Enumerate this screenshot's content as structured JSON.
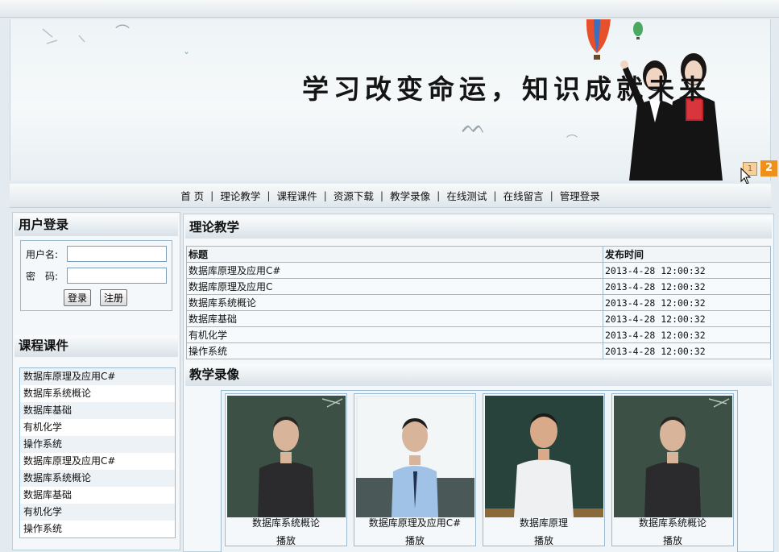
{
  "banner": {
    "slogan": "学习改变命运，知识成就未来",
    "slides": [
      "1",
      "2"
    ]
  },
  "nav": [
    "首 页",
    "理论教学",
    "课程课件",
    "资源下载",
    "教学录像",
    "在线测试",
    "在线留言",
    "管理登录"
  ],
  "nav_separator": "|",
  "login": {
    "title": "用户登录",
    "username_label": "用户名:",
    "password_label": "密　码:",
    "login_button": "登录",
    "register_button": "注册"
  },
  "courses": {
    "title": "课程课件",
    "items": [
      "数据库原理及应用C#",
      "数据库系统概论",
      "数据库基础",
      "有机化学",
      "操作系统",
      "数据库原理及应用C#",
      "数据库系统概论",
      "数据库基础",
      "有机化学",
      "操作系统"
    ]
  },
  "theory": {
    "title": "理论教学",
    "columns": [
      "标题",
      "发布时间"
    ],
    "rows": [
      [
        "数据库原理及应用C#",
        "2013-4-28 12:00:32"
      ],
      [
        "数据库原理及应用C",
        "2013-4-28 12:00:32"
      ],
      [
        "数据库系统概论",
        "2013-4-28 12:00:32"
      ],
      [
        "数据库基础",
        "2013-4-28 12:00:32"
      ],
      [
        "有机化学",
        "2013-4-28 12:00:32"
      ],
      [
        "操作系统",
        "2013-4-28 12:00:32"
      ]
    ]
  },
  "videos": {
    "title": "教学录像",
    "play_label": "播放",
    "items": [
      {
        "caption": "数据库系统概论"
      },
      {
        "caption": "数据库原理及应用C#"
      },
      {
        "caption": "数据库原理"
      },
      {
        "caption": "数据库系统概论"
      }
    ]
  }
}
